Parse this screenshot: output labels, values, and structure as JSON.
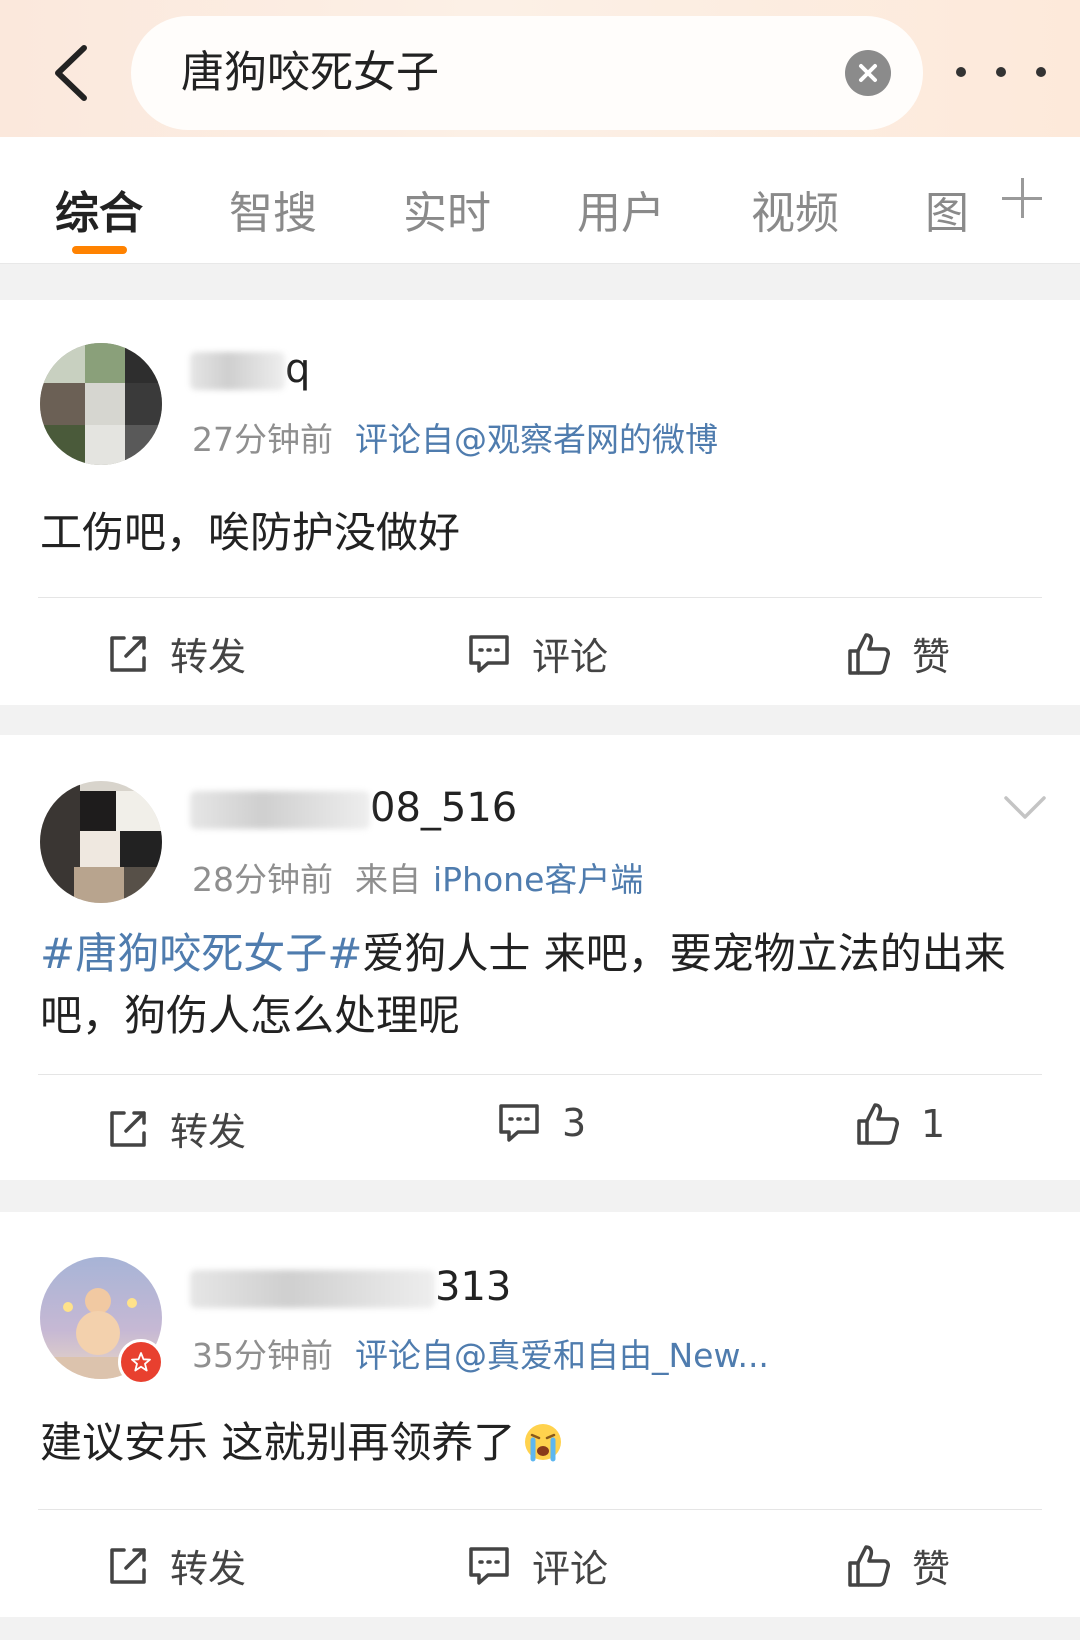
{
  "search": {
    "query": "唐狗咬死女子"
  },
  "tabs": [
    "综合",
    "智搜",
    "实时",
    "用户",
    "视频",
    "图"
  ],
  "posts": [
    {
      "username_visible": "q",
      "time": "27分钟前",
      "source": "评论自@观察者网的微博",
      "text": "工伤吧，唉防护没做好",
      "actions": {
        "repost": "转发",
        "comment": "评论",
        "like": "赞"
      }
    },
    {
      "username_visible": "08_516",
      "time": "28分钟前",
      "from_label": "来自",
      "source": "iPhone客户端",
      "topic": "#唐狗咬死女子#",
      "text": "爱狗人士 来吧，要宠物立法的出来吧，狗伤人怎么处理呢",
      "actions": {
        "repost": "转发",
        "comment": "3",
        "like": "1"
      }
    },
    {
      "username_visible": "313",
      "time": "35分钟前",
      "source": "评论自@真爱和自由_New...",
      "text": "建议安乐 这就别再领养了",
      "emoji": "crying-face",
      "actions": {
        "repost": "转发",
        "comment": "评论",
        "like": "赞"
      }
    }
  ],
  "colors": {
    "accent": "#ff8200",
    "link": "#4f7cae",
    "badge": "#e8402f"
  }
}
